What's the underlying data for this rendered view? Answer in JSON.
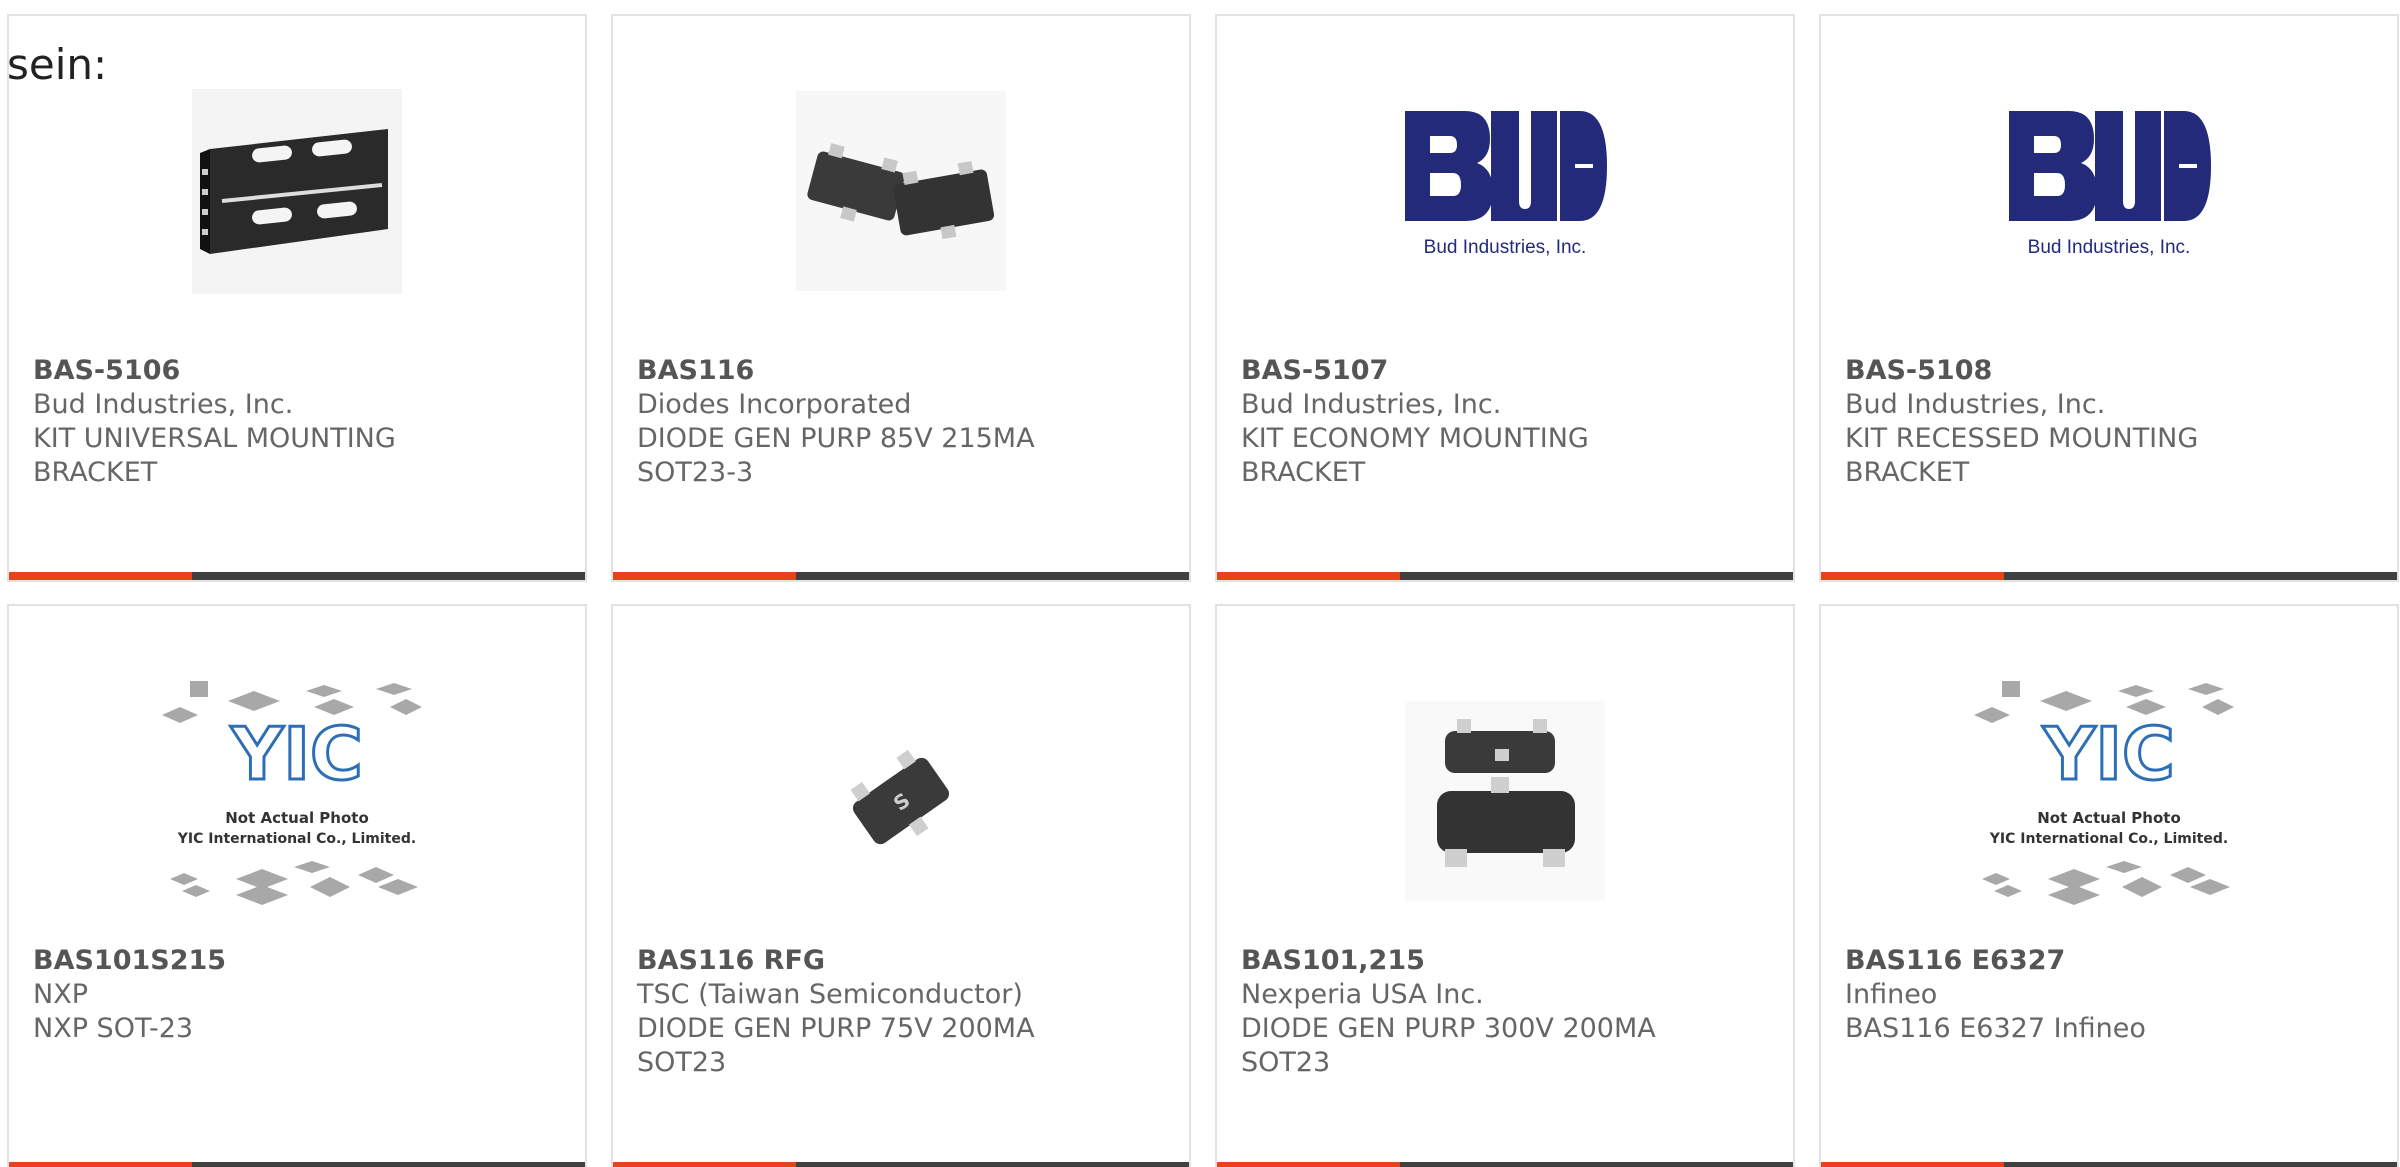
{
  "intro_text": "sein:",
  "colors": {
    "accent": "#e8421a",
    "bar": "#404040",
    "bud_blue": "#232a7a",
    "yic_blue": "#2d6fb7"
  },
  "cards": [
    {
      "part": "BAS-5106",
      "manufacturer": "Bud Industries, Inc.",
      "desc1": "KIT UNIVERSAL MOUNTING",
      "desc2": "BRACKET",
      "image": "mounting-bracket-icon"
    },
    {
      "part": "BAS116",
      "manufacturer": "Diodes Incorporated",
      "desc1": "DIODE GEN PURP 85V 215MA",
      "desc2": "SOT23-3",
      "image": "sot23-chip-icon"
    },
    {
      "part": "BAS-5107",
      "manufacturer": "Bud Industries, Inc.",
      "desc1": "KIT ECONOMY MOUNTING",
      "desc2": "BRACKET",
      "image": "bud-logo",
      "logo_caption": "Bud Industries, Inc."
    },
    {
      "part": "BAS-5108",
      "manufacturer": "Bud Industries, Inc.",
      "desc1": "KIT RECESSED MOUNTING",
      "desc2": "BRACKET",
      "image": "bud-logo",
      "logo_caption": "Bud Industries, Inc."
    },
    {
      "part": "BAS101S215",
      "manufacturer": "NXP",
      "desc1": "NXP SOT-23",
      "desc2": "",
      "image": "yic-placeholder",
      "placeholder_line1": "Not Actual Photo",
      "placeholder_line2": "YIC International Co., Limited."
    },
    {
      "part": "BAS116 RFG",
      "manufacturer": "TSC (Taiwan Semiconductor)",
      "desc1": "DIODE GEN PURP 75V 200MA",
      "desc2": "SOT23",
      "image": "sot23-chip-icon"
    },
    {
      "part": "BAS101,215",
      "manufacturer": "Nexperia USA Inc.",
      "desc1": "DIODE GEN PURP 300V 200MA",
      "desc2": "SOT23",
      "image": "sot23-chip-icon"
    },
    {
      "part": "BAS116 E6327",
      "manufacturer": "Infineo",
      "desc1": "BAS116 E6327 Infineo",
      "desc2": "",
      "image": "yic-placeholder",
      "placeholder_line1": "Not Actual Photo",
      "placeholder_line2": "YIC International Co., Limited."
    }
  ]
}
